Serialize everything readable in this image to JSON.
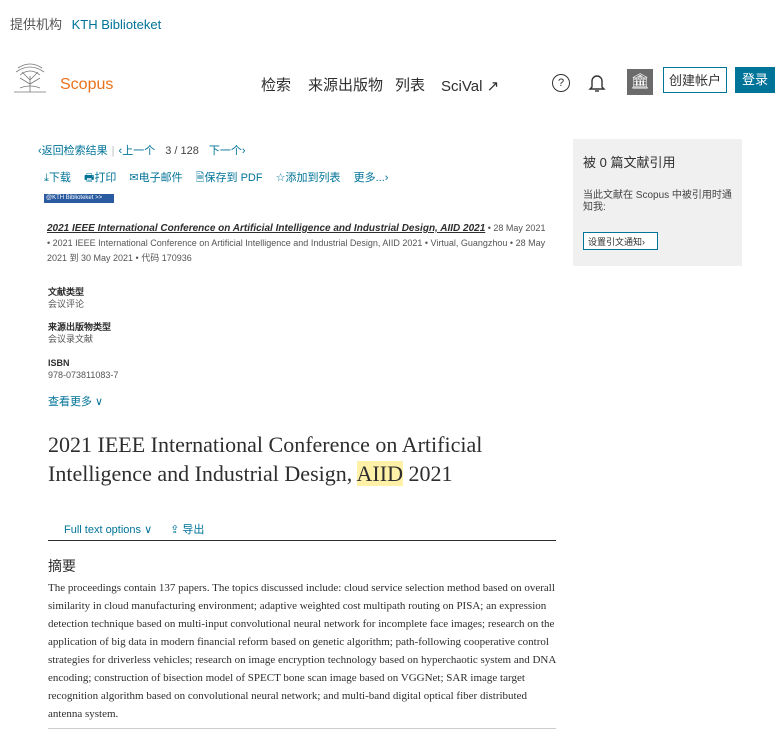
{
  "top": {
    "provider_label": "提供机构",
    "institution": "KTH Biblioteket"
  },
  "header": {
    "brand": "Scopus",
    "nav": [
      "检索",
      "来源出版物",
      "列表",
      "SciVal ↗"
    ],
    "help_glyph": "?",
    "institution_glyph": "🏛",
    "create_account": "创建帐户",
    "login": "登录"
  },
  "crumbs": {
    "back": "‹返回检索结果",
    "prev": "‹上一个",
    "current": "3",
    "slash": "/",
    "total": "128",
    "next": "下一个›"
  },
  "actions": [
    "⤓下载",
    "🖶打印",
    "✉电子邮件",
    "🗎保存到 PDF",
    "☆添加到列表",
    "更多...›"
  ],
  "badge": "@KTH Biblioteket >>",
  "source": {
    "title": "2021 IEEE International Conference on Artificial Intelligence and Industrial Design, AIID 2021",
    "rest": " • 28 May 2021 • 2021 IEEE International Conference on Artificial Intelligence and Industrial Design, AIID 2021 • Virtual, Guangzhou • 28 May 2021 到 30 May 2021 • 代码 170936"
  },
  "meta": [
    {
      "k": "文献类型",
      "v": "会议评论"
    },
    {
      "k": "来源出版物类型",
      "v": "会议录文献"
    },
    {
      "k": "ISBN",
      "v": "978-073811083-7"
    }
  ],
  "more": "查看更多 ∨",
  "title": {
    "before": "2021 IEEE International Conference on Artificial Intelligence and Industrial Design, ",
    "highlight": "AIID",
    "after": " 2021"
  },
  "tabs": {
    "fulltext": "Full text options ∨",
    "export": "⇪ 导出"
  },
  "abstract": {
    "heading": "摘要",
    "body": "The proceedings contain 137 papers. The topics discussed include: cloud service selection method based on overall similarity in cloud manufacturing environment; adaptive weighted cost multipath routing on PISA; an expression detection technique based on multi-input convolutional neural network for incomplete face images; research on the application of big data in modern financial reform based on genetic algorithm; path-following cooperative control strategies for driverless vehicles; research on image encryption technology based on hyperchaotic system and DNA encoding; construction of bisection model of SPECT bone scan image based on VGGNet; SAR image target recognition algorithm based on convolutional neural network; and multi-band digital optical fiber distributed antenna system."
  },
  "sidebar": {
    "heading": "被 0 篇文献引用",
    "desc": "当此文献在 Scopus 中被引用时通知我:",
    "button": "设置引文通知›"
  }
}
